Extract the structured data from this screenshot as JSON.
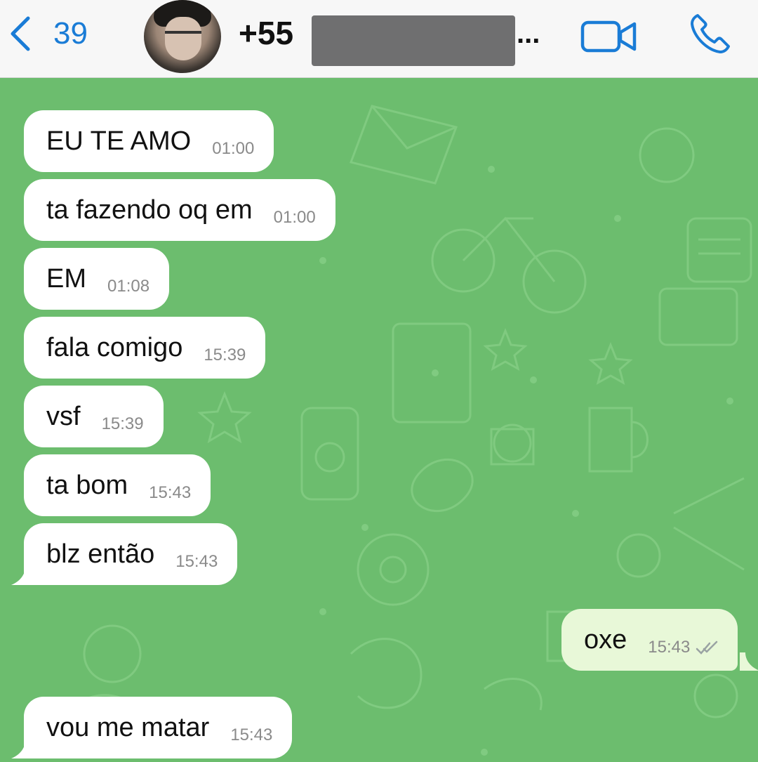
{
  "header": {
    "back_count": "39",
    "contact_prefix": "+55",
    "contact_suffix": "...",
    "icons": {
      "back": "chevron-left-icon",
      "video": "video-camera-icon",
      "call": "phone-icon"
    },
    "accent_color": "#1a7cd6"
  },
  "chat": {
    "wallpaper_color": "#6cbd6e",
    "messages": [
      {
        "text": "EU TE AMO",
        "time": "01:00",
        "direction": "incoming"
      },
      {
        "text": "ta fazendo oq em",
        "time": "01:00",
        "direction": "incoming"
      },
      {
        "text": "EM",
        "time": "01:08",
        "direction": "incoming"
      },
      {
        "text": "fala comigo",
        "time": "15:39",
        "direction": "incoming"
      },
      {
        "text": "vsf",
        "time": "15:39",
        "direction": "incoming"
      },
      {
        "text": "ta bom",
        "time": "15:43",
        "direction": "incoming"
      },
      {
        "text": "blz então",
        "time": "15:43",
        "direction": "incoming"
      },
      {
        "text": "oxe",
        "time": "15:43",
        "direction": "outgoing",
        "status": "read"
      },
      {
        "text": "vou me matar",
        "time": "15:43",
        "direction": "incoming"
      }
    ]
  }
}
